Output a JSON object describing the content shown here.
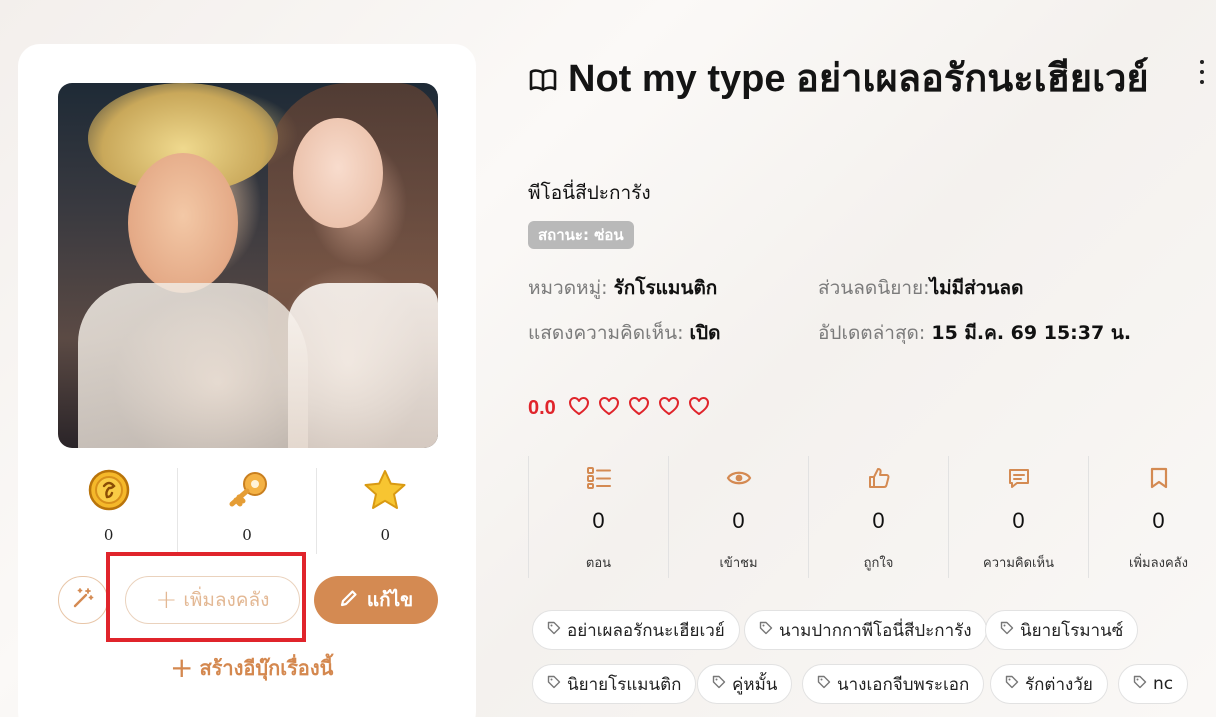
{
  "book": {
    "title": "Not my type อย่าเผลอรักนะเฮียเวย์",
    "author": "พีโอนี่สีปะการัง",
    "status": "สถานะ: ซ่อน",
    "meta": {
      "category_label": "หมวดหมู่:",
      "category_value": "รักโรแมนติก",
      "discount_label": "ส่วนลดนิยาย:",
      "discount_value": "ไม่มีส่วนลด",
      "comments_label": "แสดงความคิดเห็น:",
      "comments_value": "เปิด",
      "updated_label": "อัปเดตล่าสุด:",
      "updated_value": "15 มี.ค. 69 15:37 น."
    },
    "rating": {
      "score": "0.0",
      "hearts": 5
    }
  },
  "sidebar": {
    "stats": [
      {
        "icon": "coin-icon",
        "value": "0"
      },
      {
        "icon": "key-icon",
        "value": "0"
      },
      {
        "icon": "star-icon",
        "value": "0"
      }
    ],
    "add_to_library_label": "เพิ่มลงคลัง",
    "edit_label": "แก้ไข",
    "create_ebook_label": "สร้างอีบุ๊กเรื่องนี้"
  },
  "counters": [
    {
      "icon": "episodes-list-icon",
      "value": "0",
      "label": "ตอน"
    },
    {
      "icon": "eye-icon",
      "value": "0",
      "label": "เข้าชม"
    },
    {
      "icon": "thumbs-up-icon",
      "value": "0",
      "label": "ถูกใจ"
    },
    {
      "icon": "comment-icon",
      "value": "0",
      "label": "ความคิดเห็น"
    },
    {
      "icon": "bookmark-icon",
      "value": "0",
      "label": "เพิ่มลงคลัง"
    }
  ],
  "tags": [
    "อย่าเผลอรักนะเฮียเวย์",
    "นามปากกาพีโอนี่สีปะการัง",
    "นิยายโรมานซ์",
    "นิยายโรแมนติก",
    "คู่หมั้น",
    "นางเอกจีบพระเอก",
    "รักต่างวัย",
    "nc"
  ],
  "colors": {
    "accent": "#d48a52",
    "rating_red": "#e0242b",
    "highlight_red": "#e0242b",
    "status_gray": "#b9b9b9"
  }
}
